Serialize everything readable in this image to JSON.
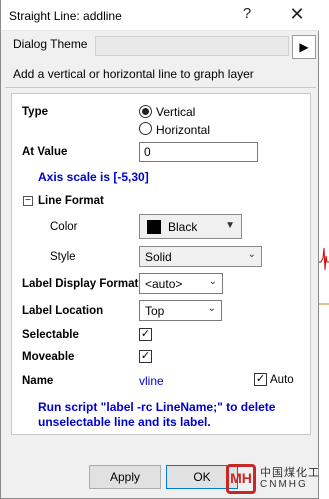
{
  "window": {
    "title": "Straight Line: addline",
    "help_glyph": "?",
    "close_glyph": "✕"
  },
  "theme": {
    "label": "Dialog Theme",
    "value": "",
    "arrow_glyph": "▶"
  },
  "description": "Add a vertical or horizontal line to graph layer",
  "form": {
    "type_label": "Type",
    "type_options": [
      "Vertical",
      "Horizontal"
    ],
    "type_selected": "Vertical",
    "at_value_label": "At Value",
    "at_value": "0",
    "axis_scale_note": "Axis scale is [-5,30]",
    "line_format_label": "Line Format",
    "line_format_toggle": "−",
    "color_label": "Color",
    "color_value": "Black",
    "color_hex": "#000000",
    "style_label": "Style",
    "style_value": "Solid",
    "label_display_format_label": "Label Display Format",
    "label_display_format_value": "<auto>",
    "label_location_label": "Label Location",
    "label_location_value": "Top",
    "selectable_label": "Selectable",
    "selectable_checked": true,
    "moveable_label": "Moveable",
    "moveable_checked": true,
    "name_label": "Name",
    "name_value": "vline",
    "auto_label": "Auto",
    "auto_checked": true,
    "script_note": "Run script \"label -rc LineName;\" to delete unselectable line and its label.",
    "check_glyph": "✓",
    "dropdown_glyph": "▼",
    "chevron_glyph": "⌄"
  },
  "buttons": {
    "apply": "Apply",
    "ok": "OK"
  },
  "watermark": {
    "logo_text": "MH",
    "cn": "中国煤化工",
    "en": "CNMHG"
  },
  "colors": {
    "accent_blue": "#0000cc",
    "ok_border": "#0078d7",
    "plot_line": "#cc0000"
  }
}
